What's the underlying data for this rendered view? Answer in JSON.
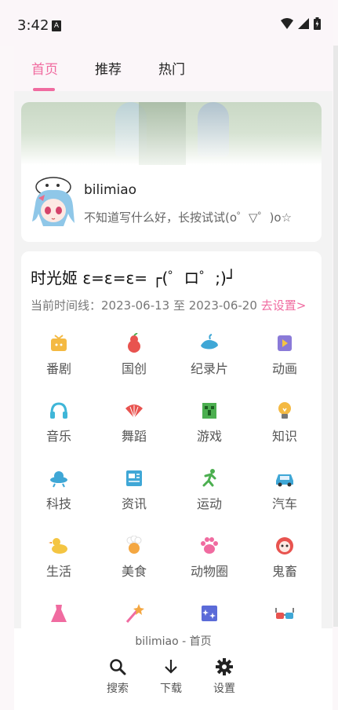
{
  "status_bar": {
    "time": "3:42",
    "notification_glyph": "A"
  },
  "tabs": [
    {
      "label": "首页",
      "active": true
    },
    {
      "label": "推荐",
      "active": false
    },
    {
      "label": "热门",
      "active": false
    }
  ],
  "profile": {
    "username": "bilimiao",
    "signature": "不知道写什么好，长按试试(o゜▽゜)o☆"
  },
  "time_card": {
    "title": "时光姬 ε=ε=ε= ┌(゜ロ゜;)┘",
    "timeline_prefix": "当前时间线：",
    "timeline_range": "2023-06-13 至 2023-06-20",
    "timeline_link": "去设置>"
  },
  "categories": [
    {
      "label": "番剧",
      "icon": "tv-icon",
      "color": "#f4b942"
    },
    {
      "label": "国创",
      "icon": "gourd-icon",
      "color": "#e8534f"
    },
    {
      "label": "纪录片",
      "icon": "whale-icon",
      "color": "#3fa7d6"
    },
    {
      "label": "动画",
      "icon": "play-card-icon",
      "color": "#8a7ad8"
    },
    {
      "label": "音乐",
      "icon": "headphones-icon",
      "color": "#3fb6d8"
    },
    {
      "label": "舞蹈",
      "icon": "fan-icon",
      "color": "#e8534f"
    },
    {
      "label": "游戏",
      "icon": "creeper-icon",
      "color": "#4caf50"
    },
    {
      "label": "知识",
      "icon": "lightbulb-icon",
      "color": "#f4b942"
    },
    {
      "label": "科技",
      "icon": "ufo-icon",
      "color": "#3fa7d6"
    },
    {
      "label": "资讯",
      "icon": "newspaper-icon",
      "color": "#3fa7d6"
    },
    {
      "label": "运动",
      "icon": "runner-icon",
      "color": "#4caf50"
    },
    {
      "label": "汽车",
      "icon": "car-icon",
      "color": "#3fa7d6"
    },
    {
      "label": "生活",
      "icon": "duck-icon",
      "color": "#f4c542"
    },
    {
      "label": "美食",
      "icon": "chef-icon",
      "color": "#f4a742"
    },
    {
      "label": "动物圈",
      "icon": "paw-icon",
      "color": "#f06ba0"
    },
    {
      "label": "鬼畜",
      "icon": "ghost-face-icon",
      "color": "#e8534f"
    },
    {
      "label": "",
      "icon": "dress-icon",
      "color": "#f06ba0"
    },
    {
      "label": "",
      "icon": "magic-wand-icon",
      "color": "#f4a742"
    },
    {
      "label": "",
      "icon": "sparkle-box-icon",
      "color": "#5b6bd8"
    },
    {
      "label": "",
      "icon": "3d-glasses-icon",
      "color": "#e8534f"
    }
  ],
  "bottom_bar": {
    "title": "bilimiao - 首页",
    "search_label": "搜索",
    "download_label": "下载",
    "settings_label": "设置"
  },
  "colors": {
    "accent": "#f06ba0",
    "background": "#f3f3f3"
  }
}
